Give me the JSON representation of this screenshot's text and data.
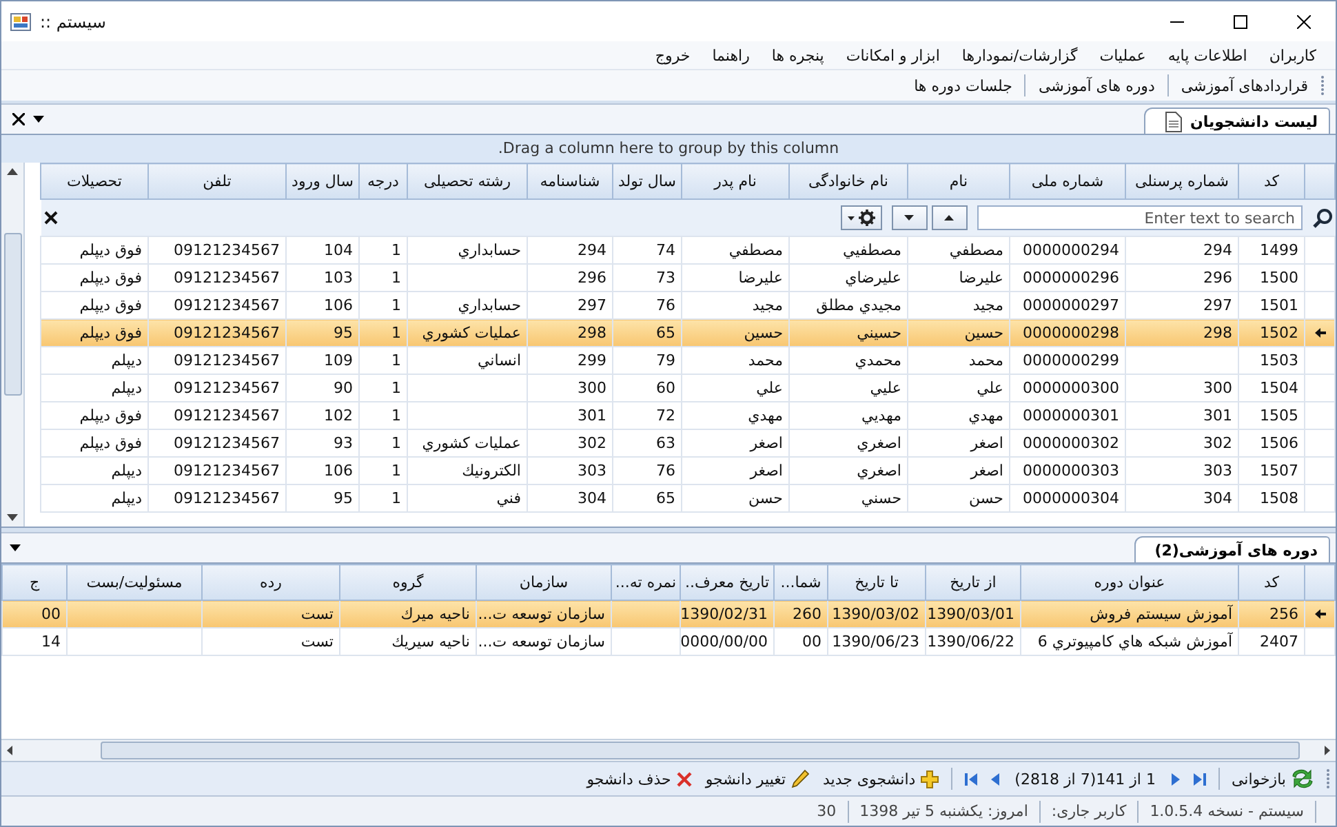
{
  "window": {
    "title": ":: سیستم"
  },
  "menu": [
    "کاربران",
    "اطلاعات پایه",
    "عملیات",
    "گزارشات/نمودارها",
    "ابزار و امکانات",
    "پنجره ها",
    "راهنما",
    "خروج"
  ],
  "toolbar": [
    "قراردادهای آموزشی",
    "دوره های آموزشی",
    "جلسات دوره ها"
  ],
  "document_tabs": [
    {
      "label": "لیست دانشجویان",
      "selected": true
    }
  ],
  "students_grid": {
    "group_panel": "Drag a column here to group by this column.",
    "search": {
      "placeholder": "Enter text to search"
    },
    "columns": [
      "کد",
      "شماره پرسنلی",
      "شماره ملی",
      "نام",
      "نام خانوادگی",
      "نام پدر",
      "سال تولد",
      "شناسنامه",
      "رشته تحصیلی",
      "درجه",
      "سال ورود",
      "تلفن",
      "تحصیلات"
    ],
    "rows": [
      {
        "selected": false,
        "cells": [
          "1499",
          "294",
          "0000000294",
          "مصطفي",
          "مصطفيي",
          "مصطفي",
          "74",
          "294",
          "حسابداري",
          "1",
          "104",
          "09121234567",
          "فوق ديپلم"
        ]
      },
      {
        "selected": false,
        "cells": [
          "1500",
          "296",
          "0000000296",
          "عليرضا",
          "عليرضاي",
          "عليرضا",
          "73",
          "296",
          "",
          "1",
          "103",
          "09121234567",
          "فوق ديپلم"
        ]
      },
      {
        "selected": false,
        "cells": [
          "1501",
          "297",
          "0000000297",
          "مجيد",
          "مجيدي مطلق",
          "مجيد",
          "76",
          "297",
          "حسابداري",
          "1",
          "106",
          "09121234567",
          "فوق ديپلم"
        ]
      },
      {
        "selected": true,
        "cells": [
          "1502",
          "298",
          "0000000298",
          "حسين",
          "حسيني",
          "حسين",
          "65",
          "298",
          "عمليات كشوري",
          "1",
          "95",
          "09121234567",
          "فوق ديپلم"
        ]
      },
      {
        "selected": false,
        "cells": [
          "1503",
          "",
          "0000000299",
          "محمد",
          "محمدي",
          "محمد",
          "79",
          "299",
          "انساني",
          "1",
          "109",
          "09121234567",
          "ديپلم"
        ]
      },
      {
        "selected": false,
        "cells": [
          "1504",
          "300",
          "0000000300",
          "علي",
          "عليي",
          "علي",
          "60",
          "300",
          "",
          "1",
          "90",
          "09121234567",
          "ديپلم"
        ]
      },
      {
        "selected": false,
        "cells": [
          "1505",
          "301",
          "0000000301",
          "مهدي",
          "مهديي",
          "مهدي",
          "72",
          "301",
          "",
          "1",
          "102",
          "09121234567",
          "فوق ديپلم"
        ]
      },
      {
        "selected": false,
        "cells": [
          "1506",
          "302",
          "0000000302",
          "اصغر",
          "اصغري",
          "اصغر",
          "63",
          "302",
          "عمليات كشوري",
          "1",
          "93",
          "09121234567",
          "فوق ديپلم"
        ]
      },
      {
        "selected": false,
        "cells": [
          "1507",
          "303",
          "0000000303",
          "اصغر",
          "اصغري",
          "اصغر",
          "76",
          "303",
          "الكترونيك",
          "1",
          "106",
          "09121234567",
          "ديپلم"
        ]
      },
      {
        "selected": false,
        "cells": [
          "1508",
          "304",
          "0000000304",
          "حسن",
          "حسني",
          "حسن",
          "65",
          "304",
          "فني",
          "1",
          "95",
          "09121234567",
          "ديپلم"
        ]
      }
    ]
  },
  "detail_tabs": [
    {
      "label": "دوره های آموزشی(2)",
      "selected": true
    }
  ],
  "courses_grid": {
    "columns": [
      "کد",
      "عنوان دوره",
      "از تاریخ",
      "تا تاریخ",
      "شما...",
      "تاریخ معرف..",
      "نمره ته...",
      "سازمان",
      "گروه",
      "رده",
      "مسئولیت/بست",
      "ج"
    ],
    "rows": [
      {
        "selected": true,
        "cells": [
          "256",
          "آموزش سيستم فروش",
          "1390/03/01",
          "1390/03/02",
          "260",
          "1390/02/31",
          "",
          "سازمان توسعه ت...",
          "ناحيه ميرك",
          "تست",
          "",
          "00"
        ]
      },
      {
        "selected": false,
        "cells": [
          "2407",
          "آموزش شبكه هاي كامپيوتري 6",
          "1390/06/22",
          "1390/06/23",
          "00",
          "0000/00/00",
          "",
          "سازمان توسعه ت...",
          "ناحيه سيريك",
          "تست",
          "",
          "14"
        ]
      }
    ]
  },
  "bottom_toolbar": [
    {
      "kind": "refresh",
      "label": "بازخوانی"
    },
    {
      "kind": "pager",
      "label": "1 از 141(7 از 2818)"
    },
    {
      "kind": "add",
      "label": "دانشجوی جدید"
    },
    {
      "kind": "edit",
      "label": "تغییر دانشجو"
    },
    {
      "kind": "delete",
      "label": "حذف دانشجو"
    }
  ],
  "status_bar": [
    "سیستم - نسخه 1.0.5.4",
    "کاربر جاری:",
    "امروز: یکشنبه 5 تیر 1398",
    "30"
  ]
}
